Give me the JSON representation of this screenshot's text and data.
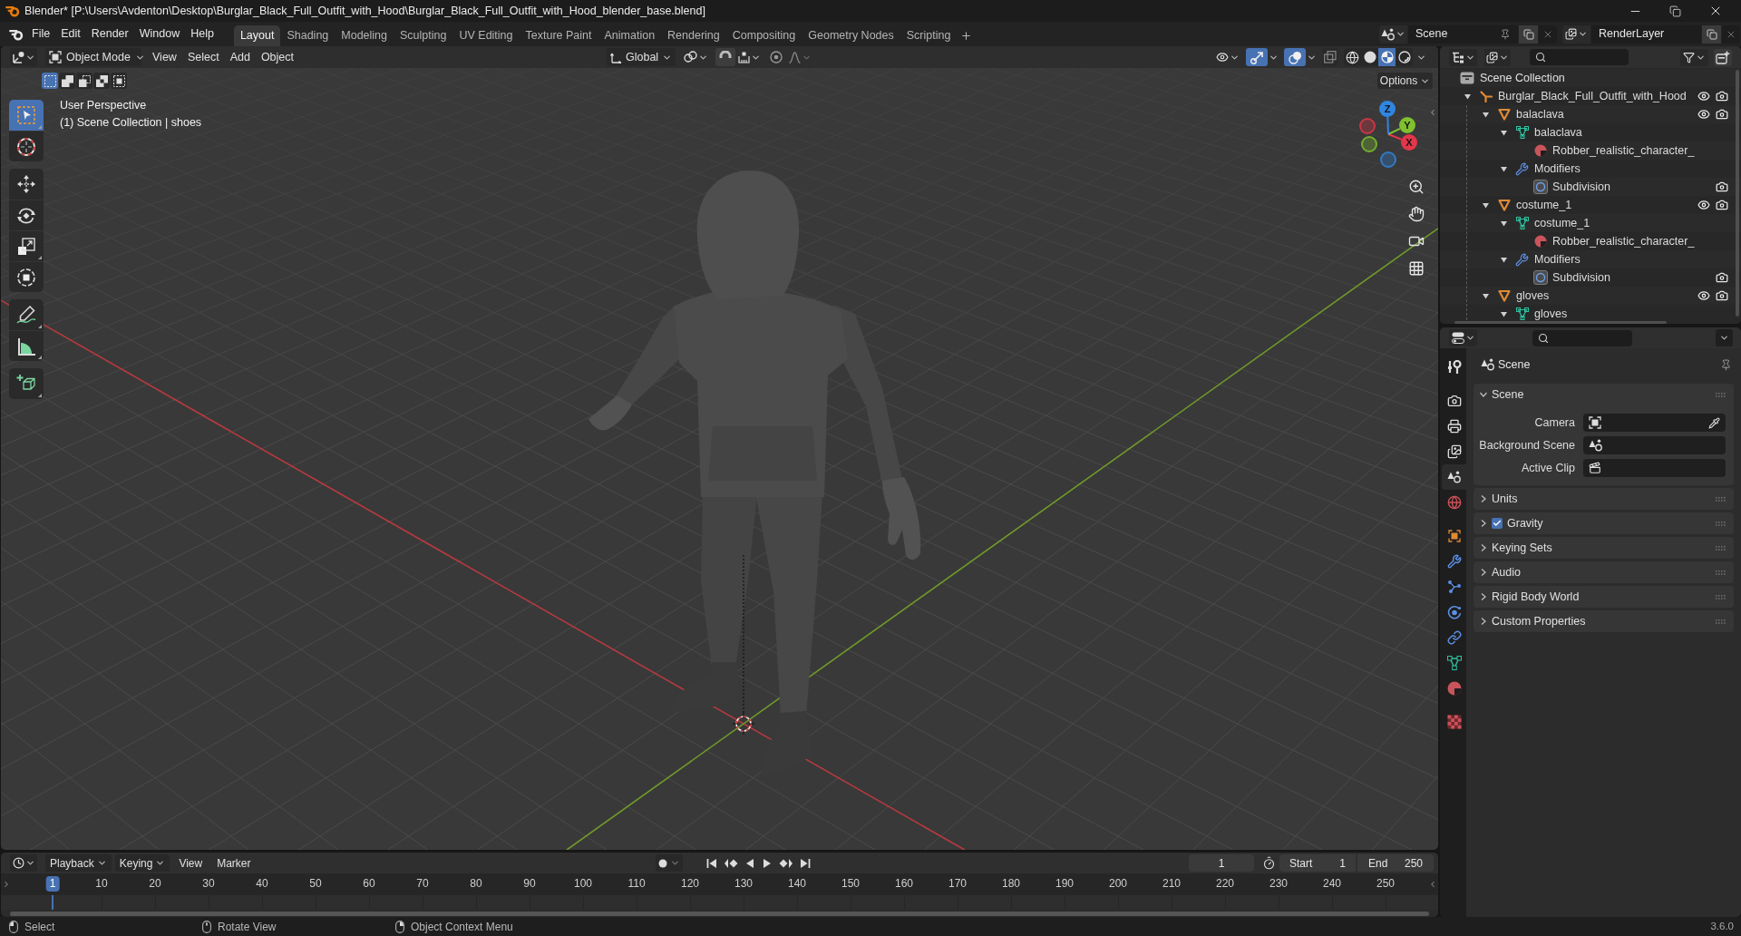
{
  "window": {
    "title": "Blender* [P:\\Users\\Avdenton\\Desktop\\Burglar_Black_Full_Outfit_with_Hood\\Burglar_Black_Full_Outfit_with_Hood_blender_base.blend]"
  },
  "menu": [
    "File",
    "Edit",
    "Render",
    "Window",
    "Help"
  ],
  "workspaces": [
    {
      "label": "Layout",
      "selected": true
    },
    {
      "label": "Shading",
      "selected": false
    },
    {
      "label": "Modeling",
      "selected": false
    },
    {
      "label": "Sculpting",
      "selected": false
    },
    {
      "label": "UV Editing",
      "selected": false
    },
    {
      "label": "Texture Paint",
      "selected": false
    },
    {
      "label": "Animation",
      "selected": false
    },
    {
      "label": "Rendering",
      "selected": false
    },
    {
      "label": "Compositing",
      "selected": false
    },
    {
      "label": "Geometry Nodes",
      "selected": false
    },
    {
      "label": "Scripting",
      "selected": false
    }
  ],
  "scene": {
    "value": "Scene"
  },
  "view_layer": {
    "value": "RenderLayer"
  },
  "viewport": {
    "mode": "Object Mode",
    "menus": [
      "View",
      "Select",
      "Add",
      "Object"
    ],
    "orientation": "Global",
    "toggles": [
      {
        "kind": "gizmo",
        "on": true
      },
      {
        "kind": "overlay",
        "on": true
      },
      {
        "kind": "xray",
        "on": false
      }
    ],
    "shading": [
      {
        "kind": "wireframe",
        "selected": false
      },
      {
        "kind": "solid",
        "selected": false
      },
      {
        "kind": "material",
        "selected": true
      },
      {
        "kind": "rendered",
        "selected": false
      }
    ],
    "select_modes": [
      {
        "kind": "set",
        "selected": true
      },
      {
        "kind": "extend",
        "selected": false
      },
      {
        "kind": "subtract",
        "selected": false
      },
      {
        "kind": "difference",
        "selected": false
      },
      {
        "kind": "intersect",
        "selected": false
      }
    ],
    "options": "Options",
    "info": [
      "User Perspective",
      "(1) Scene Collection | shoes"
    ],
    "tool_groups": [
      [
        {
          "kind": "select",
          "selected": true
        },
        {
          "kind": "cursor",
          "selected": false
        }
      ],
      [
        {
          "kind": "move",
          "selected": false
        },
        {
          "kind": "rotate",
          "selected": false
        },
        {
          "kind": "scale",
          "selected": false
        },
        {
          "kind": "transform",
          "selected": false
        }
      ],
      [
        {
          "kind": "annotate",
          "selected": false
        },
        {
          "kind": "measure",
          "selected": false
        }
      ],
      [
        {
          "kind": "add_cube",
          "selected": false
        }
      ]
    ],
    "axes": [
      {
        "label": "X",
        "color": "#e4364a"
      },
      {
        "label": "Y",
        "color": "#7fc12e"
      },
      {
        "label": "Z",
        "color": "#2f86e0"
      }
    ]
  },
  "outliner": {
    "root": "Scene Collection",
    "items": [
      {
        "name": "Burglar_Black_Full_Outfit_with_Hood",
        "kind": "empty",
        "expanded": true,
        "visible": true,
        "render": true,
        "children": [
          {
            "name": "balaclava",
            "kind": "object",
            "expanded": true,
            "visible": true,
            "render": true,
            "children": [
              {
                "name": "balaclava",
                "kind": "mesh",
                "expanded": true,
                "children": [
                  {
                    "name": "Robber_realistic_character_",
                    "kind": "material"
                  }
                ]
              },
              {
                "name": "Modifiers",
                "kind": "modifiers",
                "expanded": true,
                "children": [
                  {
                    "name": "Subdivision",
                    "kind": "subdivision",
                    "render": true
                  }
                ]
              }
            ]
          },
          {
            "name": "costume_1",
            "kind": "object",
            "expanded": true,
            "visible": true,
            "render": true,
            "children": [
              {
                "name": "costume_1",
                "kind": "mesh",
                "expanded": true,
                "children": [
                  {
                    "name": "Robber_realistic_character_",
                    "kind": "material"
                  }
                ]
              },
              {
                "name": "Modifiers",
                "kind": "modifiers",
                "expanded": true,
                "children": [
                  {
                    "name": "Subdivision",
                    "kind": "subdivision",
                    "render": true
                  }
                ]
              }
            ]
          },
          {
            "name": "gloves",
            "kind": "object",
            "expanded": true,
            "visible": true,
            "render": true,
            "children": [
              {
                "name": "gloves",
                "kind": "mesh",
                "expanded": true
              }
            ]
          }
        ]
      }
    ]
  },
  "properties": {
    "tabs": [
      [
        {
          "kind": "tool",
          "selected": false
        }
      ],
      [
        {
          "kind": "render",
          "selected": false
        },
        {
          "kind": "output",
          "selected": false
        },
        {
          "kind": "view_layer",
          "selected": false
        },
        {
          "kind": "scene",
          "selected": true
        },
        {
          "kind": "world",
          "selected": false
        }
      ],
      [
        {
          "kind": "object",
          "selected": false
        },
        {
          "kind": "modifiers",
          "selected": false
        },
        {
          "kind": "particles",
          "selected": false
        },
        {
          "kind": "physics",
          "selected": false
        },
        {
          "kind": "constraints",
          "selected": false
        },
        {
          "kind": "data",
          "selected": false
        },
        {
          "kind": "material",
          "selected": false
        }
      ],
      [
        {
          "kind": "texture",
          "selected": false
        }
      ]
    ],
    "context": "Scene",
    "panels": [
      {
        "title": "Scene",
        "expanded": true,
        "fields": [
          {
            "label": "Camera",
            "kind": "camera"
          },
          {
            "label": "Background Scene",
            "kind": "scene"
          },
          {
            "label": "Active Clip",
            "kind": "clip"
          }
        ]
      },
      {
        "title": "Units",
        "expanded": false
      },
      {
        "title": "Gravity",
        "expanded": false,
        "checked": true
      },
      {
        "title": "Keying Sets",
        "expanded": false
      },
      {
        "title": "Audio",
        "expanded": false
      },
      {
        "title": "Rigid Body World",
        "expanded": false
      },
      {
        "title": "Custom Properties",
        "expanded": false
      }
    ]
  },
  "timeline": {
    "menus": [
      {
        "label": "Playback",
        "dropdown": true
      },
      {
        "label": "Keying",
        "dropdown": true
      },
      {
        "label": "View",
        "dropdown": false
      },
      {
        "label": "Marker",
        "dropdown": false
      }
    ],
    "current_frame": "1",
    "start": {
      "label": "Start",
      "value": "1"
    },
    "end": {
      "label": "End",
      "value": "250"
    },
    "frames": [
      {
        "label": "1",
        "selected": true
      },
      {
        "label": "10",
        "selected": false
      },
      {
        "label": "20",
        "selected": false
      },
      {
        "label": "30",
        "selected": false
      },
      {
        "label": "40",
        "selected": false
      },
      {
        "label": "50",
        "selected": false
      },
      {
        "label": "60",
        "selected": false
      },
      {
        "label": "70",
        "selected": false
      },
      {
        "label": "80",
        "selected": false
      },
      {
        "label": "90",
        "selected": false
      },
      {
        "label": "100",
        "selected": false
      },
      {
        "label": "110",
        "selected": false
      },
      {
        "label": "120",
        "selected": false
      },
      {
        "label": "130",
        "selected": false
      },
      {
        "label": "140",
        "selected": false
      },
      {
        "label": "150",
        "selected": false
      },
      {
        "label": "160",
        "selected": false
      },
      {
        "label": "170",
        "selected": false
      },
      {
        "label": "180",
        "selected": false
      },
      {
        "label": "190",
        "selected": false
      },
      {
        "label": "200",
        "selected": false
      },
      {
        "label": "210",
        "selected": false
      },
      {
        "label": "220",
        "selected": false
      },
      {
        "label": "230",
        "selected": false
      },
      {
        "label": "240",
        "selected": false
      },
      {
        "label": "250",
        "selected": false
      }
    ]
  },
  "status_bar": {
    "hints": [
      {
        "kind": "left",
        "label": "Select"
      },
      {
        "kind": "middle",
        "label": "Rotate View"
      },
      {
        "kind": "right",
        "label": "Object Context Menu"
      }
    ],
    "version": "3.6.0"
  }
}
